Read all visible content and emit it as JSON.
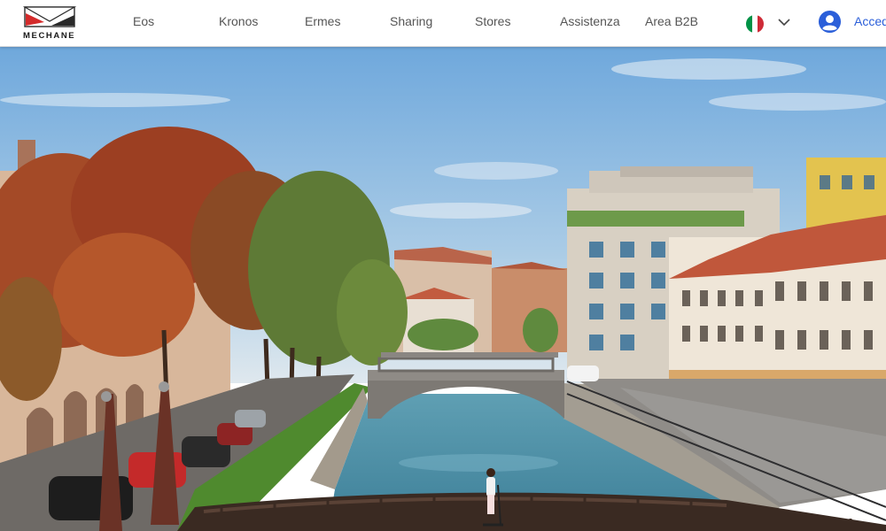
{
  "brand": {
    "name": "MECHANE"
  },
  "nav": {
    "items": [
      {
        "label": "Eos"
      },
      {
        "label": "Kronos"
      },
      {
        "label": "Ermes"
      },
      {
        "label": "Sharing"
      },
      {
        "label": "Stores"
      },
      {
        "label": "Assistenza"
      },
      {
        "label": "Area B2B"
      }
    ]
  },
  "language": {
    "icon": "italy-flag-icon",
    "colors": [
      "#009246",
      "#ffffff",
      "#ce2b37"
    ]
  },
  "account": {
    "icon": "account-circle-icon",
    "login_label": "Accedi"
  },
  "colors": {
    "accent": "#2b5fd9",
    "brand_red": "#d42b2b"
  },
  "hero": {
    "icon": "hero-photo-canal-icon"
  }
}
